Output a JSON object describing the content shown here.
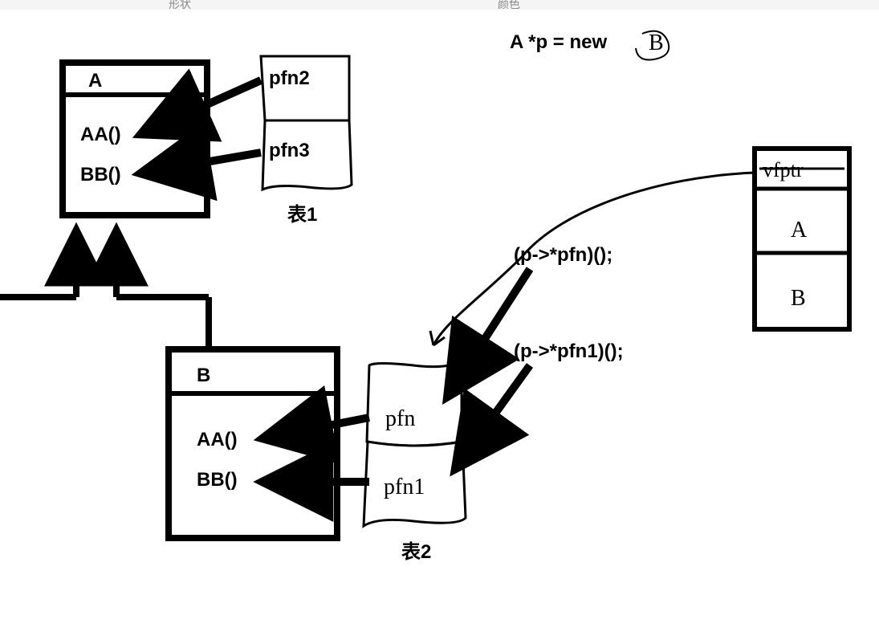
{
  "toolbar": {
    "label_left_partial": "形状",
    "label_right_partial": "颜色"
  },
  "code_line": {
    "text_prefix": "A *p = new",
    "handwritten_suffix": "B"
  },
  "class_A": {
    "name": "A",
    "method1": "AA()",
    "method2": "BB()"
  },
  "class_B": {
    "name": "B",
    "method1": "AA()",
    "method2": "BB()"
  },
  "table1": {
    "caption": "表1",
    "entry1": "pfn2",
    "entry2": "pfn3"
  },
  "table2": {
    "caption": "表2",
    "entry1": "pfn",
    "entry2": "pfn1"
  },
  "calls": {
    "call1": "(p->*pfn)();",
    "call2": "(p->*pfn1)();"
  },
  "object_box": {
    "row1": "vfptr",
    "row2": "A",
    "row3": "B"
  }
}
